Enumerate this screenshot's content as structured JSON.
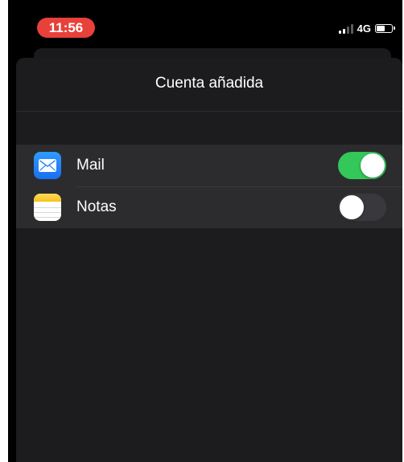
{
  "status_bar": {
    "time": "11:56",
    "network": "4G",
    "signal_bars": 4,
    "signal_active_bars": 2,
    "battery_level": 0.6,
    "time_pill_color": "#e8403a"
  },
  "sheet": {
    "title": "Cuenta añadida"
  },
  "apps": [
    {
      "label": "Mail",
      "icon": "mail-icon",
      "enabled": true
    },
    {
      "label": "Notas",
      "icon": "notes-icon",
      "enabled": false
    }
  ],
  "colors": {
    "toggle_on": "#34c759",
    "toggle_off": "#39393d",
    "sheet_bg": "#1c1c1e",
    "group_bg": "#2c2c2e"
  }
}
